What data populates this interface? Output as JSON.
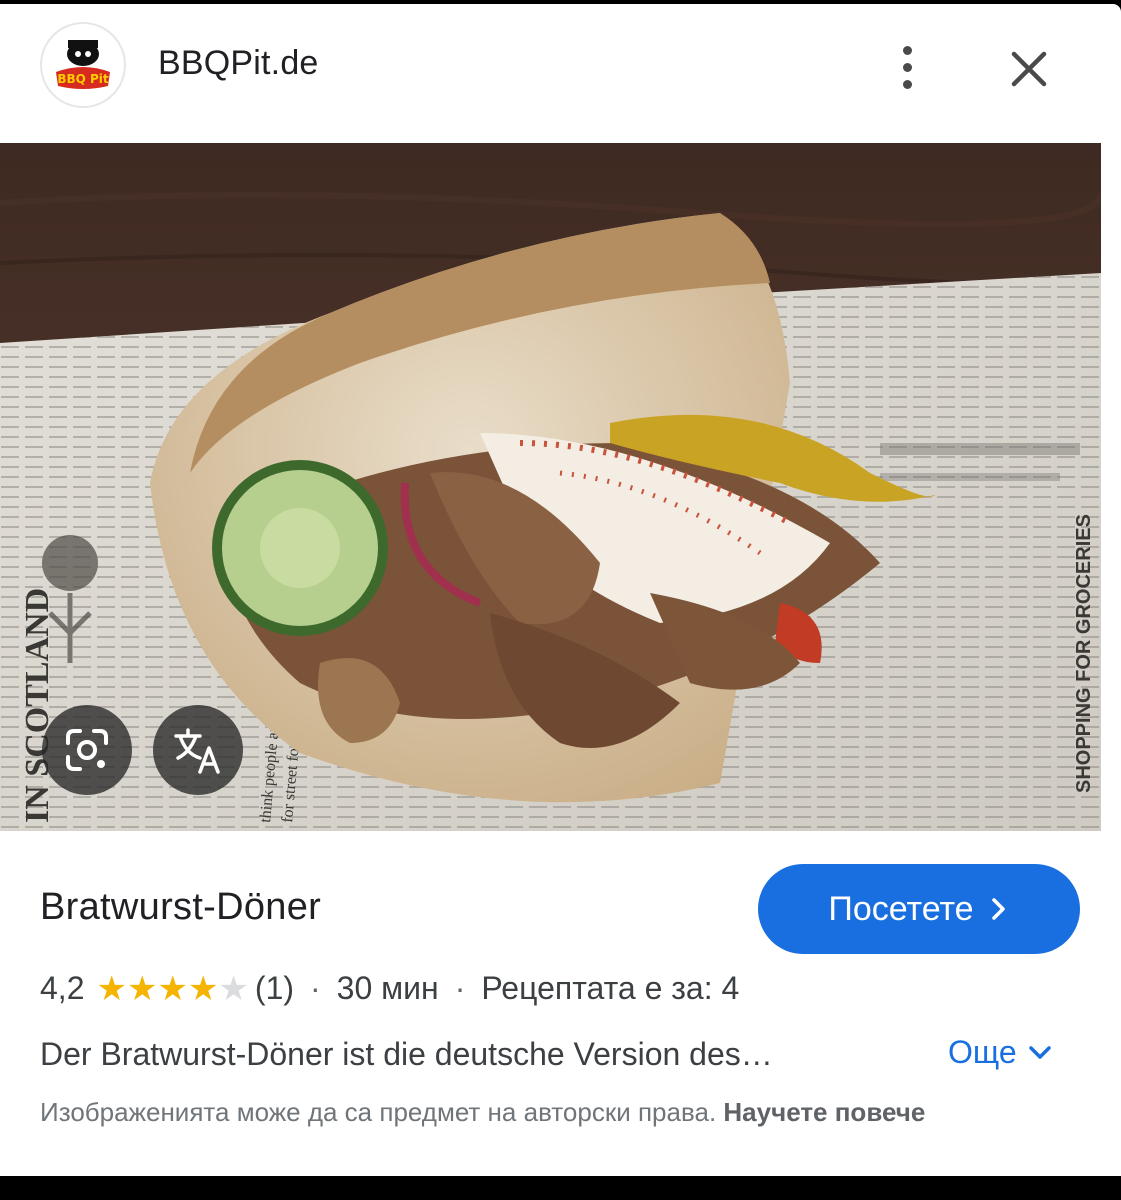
{
  "header": {
    "site_name": "BBQPit.de",
    "logo_text": "BBQ Pit"
  },
  "image": {
    "newspaper_words": [
      "IN SCOTLAND",
      "SHOPPING FOR GROCERIES",
      "think people are",
      "for street food"
    ]
  },
  "result": {
    "title": "Bratwurst-Döner",
    "visit_label": "Посетете",
    "rating": "4,2",
    "rating_value": 4.2,
    "rating_max": 5,
    "review_count": "(1)",
    "time": "30 мин",
    "servings": "Рецептата е за: 4",
    "description": "Der Bratwurst-Döner ist die deutsche Version des…",
    "more_label": "Още",
    "copyright_text": "Изображенията може да са предмет на авторски права.",
    "learn_more": "Научете повече"
  },
  "colors": {
    "accent": "#1a6fe0",
    "star_filled": "#f4b400",
    "star_empty": "#dadce0"
  }
}
